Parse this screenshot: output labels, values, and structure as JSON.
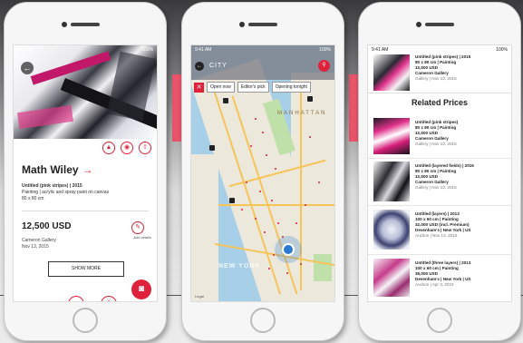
{
  "phone1": {
    "status_time": "9:41 AM",
    "status_battery": "100%",
    "artist": "Math Wiley",
    "artist_arrow": "→",
    "work_title": "Untitled (pink stripes) | 2015",
    "work_medium": "Painting | acrylic and spray paint on canvas",
    "work_size": "80 x 80 cm",
    "price": "12,500 USD",
    "gallery": "Cameron Gallery",
    "date": "Nov 13, 2015",
    "add_details": "Add details",
    "show_more": "SHOW MORE"
  },
  "phone2": {
    "status_time": "9:41 AM",
    "status_battery": "100%",
    "city": "CITY",
    "filters": [
      "Open now",
      "Editor's pick",
      "Opening tonight"
    ],
    "map_labels": {
      "manhattan": "MANHATTAN",
      "newyork": "NEW YORK"
    },
    "legal": "Legal"
  },
  "phone3": {
    "status_time": "9:41 AM",
    "status_battery": "100%",
    "top": {
      "title": "Untitled (pink stripes) | 2015",
      "detail": "80 x 80 cm | Painting",
      "price": "12,500 USD",
      "gallery": "Cameron Gallery",
      "date": "Gallery | Nov 13, 2015"
    },
    "related_title": "Related Prices",
    "items": [
      {
        "title": "Untitled (pink stripes)",
        "detail": "80 x 80 cm | Painting",
        "price": "12,500 USD",
        "source": "Cameron Gallery",
        "date": "Gallery | Nov 13, 2015"
      },
      {
        "title": "Untitled (layered fields) | 2015",
        "detail": "80 x 80 cm | Painting",
        "price": "12,500 USD",
        "source": "Cameron Gallery",
        "date": "Gallery | Nov 13, 2015"
      },
      {
        "title": "Untitled (layers) | 2013",
        "detail": "100 x 60 cm | Painting",
        "price": "32,000 USD (incl. Premium)",
        "source": "Devenham's | New York | US",
        "date": "Auction | Nov 13, 2015"
      },
      {
        "title": "Untitled (three layers) | 2013",
        "detail": "100 x 60 cm | Painting",
        "price": "36,000 USD",
        "source": "Devenham's | New York | US",
        "date": "Auction | Apr 3, 2015"
      }
    ]
  }
}
